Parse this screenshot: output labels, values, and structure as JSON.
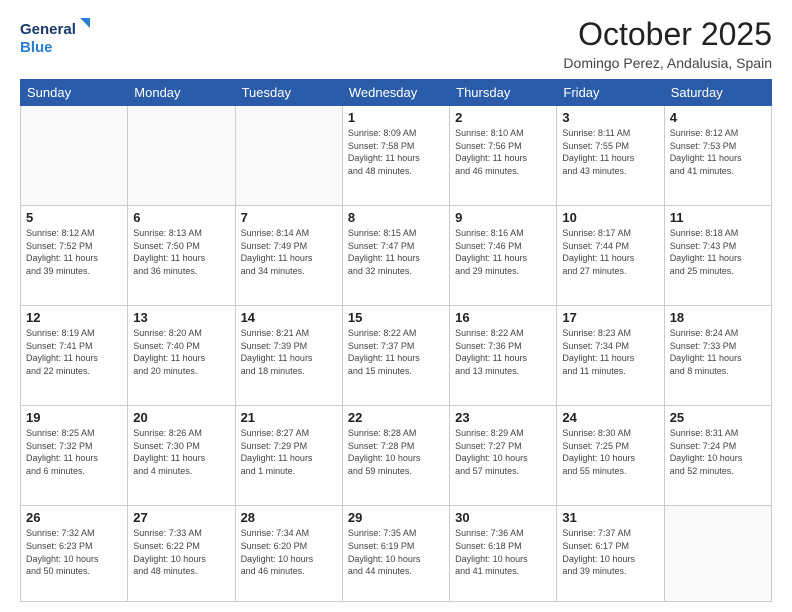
{
  "logo": {
    "line1": "General",
    "line2": "Blue"
  },
  "header": {
    "title": "October 2025",
    "subtitle": "Domingo Perez, Andalusia, Spain"
  },
  "weekdays": [
    "Sunday",
    "Monday",
    "Tuesday",
    "Wednesday",
    "Thursday",
    "Friday",
    "Saturday"
  ],
  "weeks": [
    [
      {
        "day": "",
        "info": ""
      },
      {
        "day": "",
        "info": ""
      },
      {
        "day": "",
        "info": ""
      },
      {
        "day": "1",
        "info": "Sunrise: 8:09 AM\nSunset: 7:58 PM\nDaylight: 11 hours\nand 48 minutes."
      },
      {
        "day": "2",
        "info": "Sunrise: 8:10 AM\nSunset: 7:56 PM\nDaylight: 11 hours\nand 46 minutes."
      },
      {
        "day": "3",
        "info": "Sunrise: 8:11 AM\nSunset: 7:55 PM\nDaylight: 11 hours\nand 43 minutes."
      },
      {
        "day": "4",
        "info": "Sunrise: 8:12 AM\nSunset: 7:53 PM\nDaylight: 11 hours\nand 41 minutes."
      }
    ],
    [
      {
        "day": "5",
        "info": "Sunrise: 8:12 AM\nSunset: 7:52 PM\nDaylight: 11 hours\nand 39 minutes."
      },
      {
        "day": "6",
        "info": "Sunrise: 8:13 AM\nSunset: 7:50 PM\nDaylight: 11 hours\nand 36 minutes."
      },
      {
        "day": "7",
        "info": "Sunrise: 8:14 AM\nSunset: 7:49 PM\nDaylight: 11 hours\nand 34 minutes."
      },
      {
        "day": "8",
        "info": "Sunrise: 8:15 AM\nSunset: 7:47 PM\nDaylight: 11 hours\nand 32 minutes."
      },
      {
        "day": "9",
        "info": "Sunrise: 8:16 AM\nSunset: 7:46 PM\nDaylight: 11 hours\nand 29 minutes."
      },
      {
        "day": "10",
        "info": "Sunrise: 8:17 AM\nSunset: 7:44 PM\nDaylight: 11 hours\nand 27 minutes."
      },
      {
        "day": "11",
        "info": "Sunrise: 8:18 AM\nSunset: 7:43 PM\nDaylight: 11 hours\nand 25 minutes."
      }
    ],
    [
      {
        "day": "12",
        "info": "Sunrise: 8:19 AM\nSunset: 7:41 PM\nDaylight: 11 hours\nand 22 minutes."
      },
      {
        "day": "13",
        "info": "Sunrise: 8:20 AM\nSunset: 7:40 PM\nDaylight: 11 hours\nand 20 minutes."
      },
      {
        "day": "14",
        "info": "Sunrise: 8:21 AM\nSunset: 7:39 PM\nDaylight: 11 hours\nand 18 minutes."
      },
      {
        "day": "15",
        "info": "Sunrise: 8:22 AM\nSunset: 7:37 PM\nDaylight: 11 hours\nand 15 minutes."
      },
      {
        "day": "16",
        "info": "Sunrise: 8:22 AM\nSunset: 7:36 PM\nDaylight: 11 hours\nand 13 minutes."
      },
      {
        "day": "17",
        "info": "Sunrise: 8:23 AM\nSunset: 7:34 PM\nDaylight: 11 hours\nand 11 minutes."
      },
      {
        "day": "18",
        "info": "Sunrise: 8:24 AM\nSunset: 7:33 PM\nDaylight: 11 hours\nand 8 minutes."
      }
    ],
    [
      {
        "day": "19",
        "info": "Sunrise: 8:25 AM\nSunset: 7:32 PM\nDaylight: 11 hours\nand 6 minutes."
      },
      {
        "day": "20",
        "info": "Sunrise: 8:26 AM\nSunset: 7:30 PM\nDaylight: 11 hours\nand 4 minutes."
      },
      {
        "day": "21",
        "info": "Sunrise: 8:27 AM\nSunset: 7:29 PM\nDaylight: 11 hours\nand 1 minute."
      },
      {
        "day": "22",
        "info": "Sunrise: 8:28 AM\nSunset: 7:28 PM\nDaylight: 10 hours\nand 59 minutes."
      },
      {
        "day": "23",
        "info": "Sunrise: 8:29 AM\nSunset: 7:27 PM\nDaylight: 10 hours\nand 57 minutes."
      },
      {
        "day": "24",
        "info": "Sunrise: 8:30 AM\nSunset: 7:25 PM\nDaylight: 10 hours\nand 55 minutes."
      },
      {
        "day": "25",
        "info": "Sunrise: 8:31 AM\nSunset: 7:24 PM\nDaylight: 10 hours\nand 52 minutes."
      }
    ],
    [
      {
        "day": "26",
        "info": "Sunrise: 7:32 AM\nSunset: 6:23 PM\nDaylight: 10 hours\nand 50 minutes."
      },
      {
        "day": "27",
        "info": "Sunrise: 7:33 AM\nSunset: 6:22 PM\nDaylight: 10 hours\nand 48 minutes."
      },
      {
        "day": "28",
        "info": "Sunrise: 7:34 AM\nSunset: 6:20 PM\nDaylight: 10 hours\nand 46 minutes."
      },
      {
        "day": "29",
        "info": "Sunrise: 7:35 AM\nSunset: 6:19 PM\nDaylight: 10 hours\nand 44 minutes."
      },
      {
        "day": "30",
        "info": "Sunrise: 7:36 AM\nSunset: 6:18 PM\nDaylight: 10 hours\nand 41 minutes."
      },
      {
        "day": "31",
        "info": "Sunrise: 7:37 AM\nSunset: 6:17 PM\nDaylight: 10 hours\nand 39 minutes."
      },
      {
        "day": "",
        "info": ""
      }
    ]
  ]
}
